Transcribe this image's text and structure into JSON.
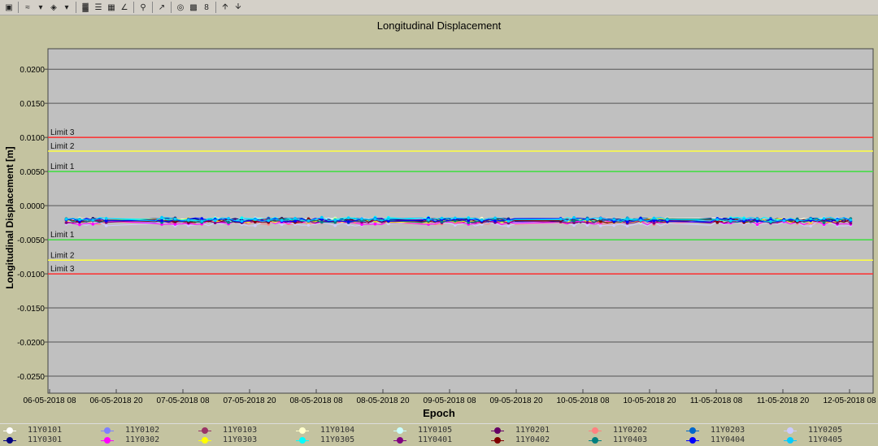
{
  "toolbar": {
    "icons": [
      "save-icon",
      "chart-type-icon",
      "dropdown-icon",
      "fill-color-icon",
      "dropdown-icon",
      "grid-icon",
      "list-icon",
      "table-icon",
      "axis-icon",
      "zoom-icon",
      "tool-icon",
      "export-icon",
      "display-icon",
      "number-icon",
      "arrow-up-icon",
      "arrow-down-icon"
    ],
    "number_label": "8"
  },
  "chart_data": {
    "type": "line",
    "title": "Longitudinal Displacement",
    "xlabel": "Epoch",
    "ylabel": "Longitudinal Displacement [m]",
    "ylim": [
      -0.0275,
      0.023
    ],
    "yticks": [
      "0.0200",
      "0.0150",
      "0.0100",
      "0.0050",
      "0.0000",
      "-0.0050",
      "-0.0100",
      "-0.0150",
      "-0.0200",
      "-0.0250"
    ],
    "ytick_values": [
      0.02,
      0.015,
      0.01,
      0.005,
      0,
      -0.005,
      -0.01,
      -0.015,
      -0.02,
      -0.025
    ],
    "xticks": [
      "06-05-2018 08",
      "06-05-2018 20",
      "07-05-2018 08",
      "07-05-2018 20",
      "08-05-2018 08",
      "08-05-2018 20",
      "09-05-2018 08",
      "09-05-2018 20",
      "10-05-2018 08",
      "10-05-2018 20",
      "11-05-2018 08",
      "11-05-2018 20",
      "12-05-2018 08"
    ],
    "grid": true,
    "background": "#c0c0c0",
    "limits": [
      {
        "label": "Limit 3",
        "value": 0.01,
        "color": "#ff3030"
      },
      {
        "label": "Limit 2",
        "value": 0.008,
        "color": "#ffff40"
      },
      {
        "label": "Limit 1",
        "value": 0.005,
        "color": "#40e040"
      },
      {
        "label": "Limit 1",
        "value": -0.005,
        "color": "#40e040"
      },
      {
        "label": "Limit 2",
        "value": -0.008,
        "color": "#ffff40"
      },
      {
        "label": "Limit 3",
        "value": -0.01,
        "color": "#ff3030"
      }
    ],
    "observation_windows": [
      [
        "06-05-2018 11",
        "06-05-2018 19"
      ],
      [
        "07-05-2018 03",
        "08-05-2018 22"
      ],
      [
        "09-05-2018 03",
        "09-05-2018 20"
      ],
      [
        "10-05-2018 04",
        "11-05-2018 00"
      ],
      [
        "11-05-2018 07",
        "12-05-2018 09"
      ]
    ],
    "legend_position": "bottom",
    "series": [
      {
        "name": "11Y0101",
        "color": "#ffffff",
        "y": -0.0021
      },
      {
        "name": "11Y0102",
        "color": "#8080ff",
        "y": -0.0022
      },
      {
        "name": "11Y0103",
        "color": "#993366",
        "y": -0.0022
      },
      {
        "name": "11Y0104",
        "color": "#ffffcc",
        "y": -0.0021
      },
      {
        "name": "11Y0105",
        "color": "#ccffff",
        "y": -0.0021
      },
      {
        "name": "11Y0201",
        "color": "#660066",
        "y": -0.0023
      },
      {
        "name": "11Y0202",
        "color": "#ff8080",
        "y": -0.0025
      },
      {
        "name": "11Y0203",
        "color": "#0066cc",
        "y": -0.0021
      },
      {
        "name": "11Y0205",
        "color": "#ccccff",
        "y": -0.0027
      },
      {
        "name": "11Y0301",
        "color": "#000080",
        "y": -0.0021
      },
      {
        "name": "11Y0302",
        "color": "#ff00ff",
        "y": -0.0025
      },
      {
        "name": "11Y0303",
        "color": "#ffff00",
        "y": -0.0022
      },
      {
        "name": "11Y0305",
        "color": "#00ffff",
        "y": -0.002
      },
      {
        "name": "11Y0401",
        "color": "#800080",
        "y": -0.0023
      },
      {
        "name": "11Y0402",
        "color": "#800000",
        "y": -0.0022
      },
      {
        "name": "11Y0403",
        "color": "#008080",
        "y": -0.0022
      },
      {
        "name": "11Y0404",
        "color": "#0000ff",
        "y": -0.0021
      },
      {
        "name": "11Y0405",
        "color": "#00ccff",
        "y": -0.002
      }
    ]
  }
}
